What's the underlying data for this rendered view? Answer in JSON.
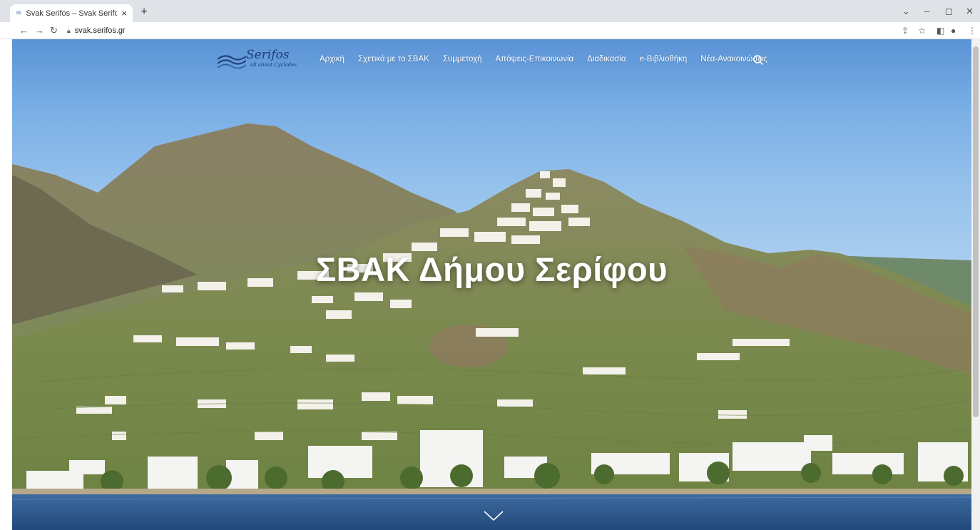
{
  "browser": {
    "tab_title": "Svak Serifos – Svak Serifou",
    "tab_close": "×",
    "new_tab": "+",
    "url": "svak.serifos.gr"
  },
  "site": {
    "logo_text": "Serifos",
    "logo_sub": "all about Cyclades",
    "nav": [
      {
        "label": "Αρχική"
      },
      {
        "label": "Σχετικά με το ΣΒΑΚ"
      },
      {
        "label": "Συμμετοχή"
      },
      {
        "label": "Απόψεις-Επικοινωνία"
      },
      {
        "label": "Διαδικασία"
      },
      {
        "label": "e-Βιβλιοθήκη"
      },
      {
        "label": "Νέα-Ανακοινώσεις"
      }
    ],
    "hero_title": "ΣΒΑΚ Δήμου Σερίφου"
  },
  "colors": {
    "sky_top": "#5a93d6",
    "sea": "#2f5a8e",
    "logo": "#1e3e78"
  }
}
